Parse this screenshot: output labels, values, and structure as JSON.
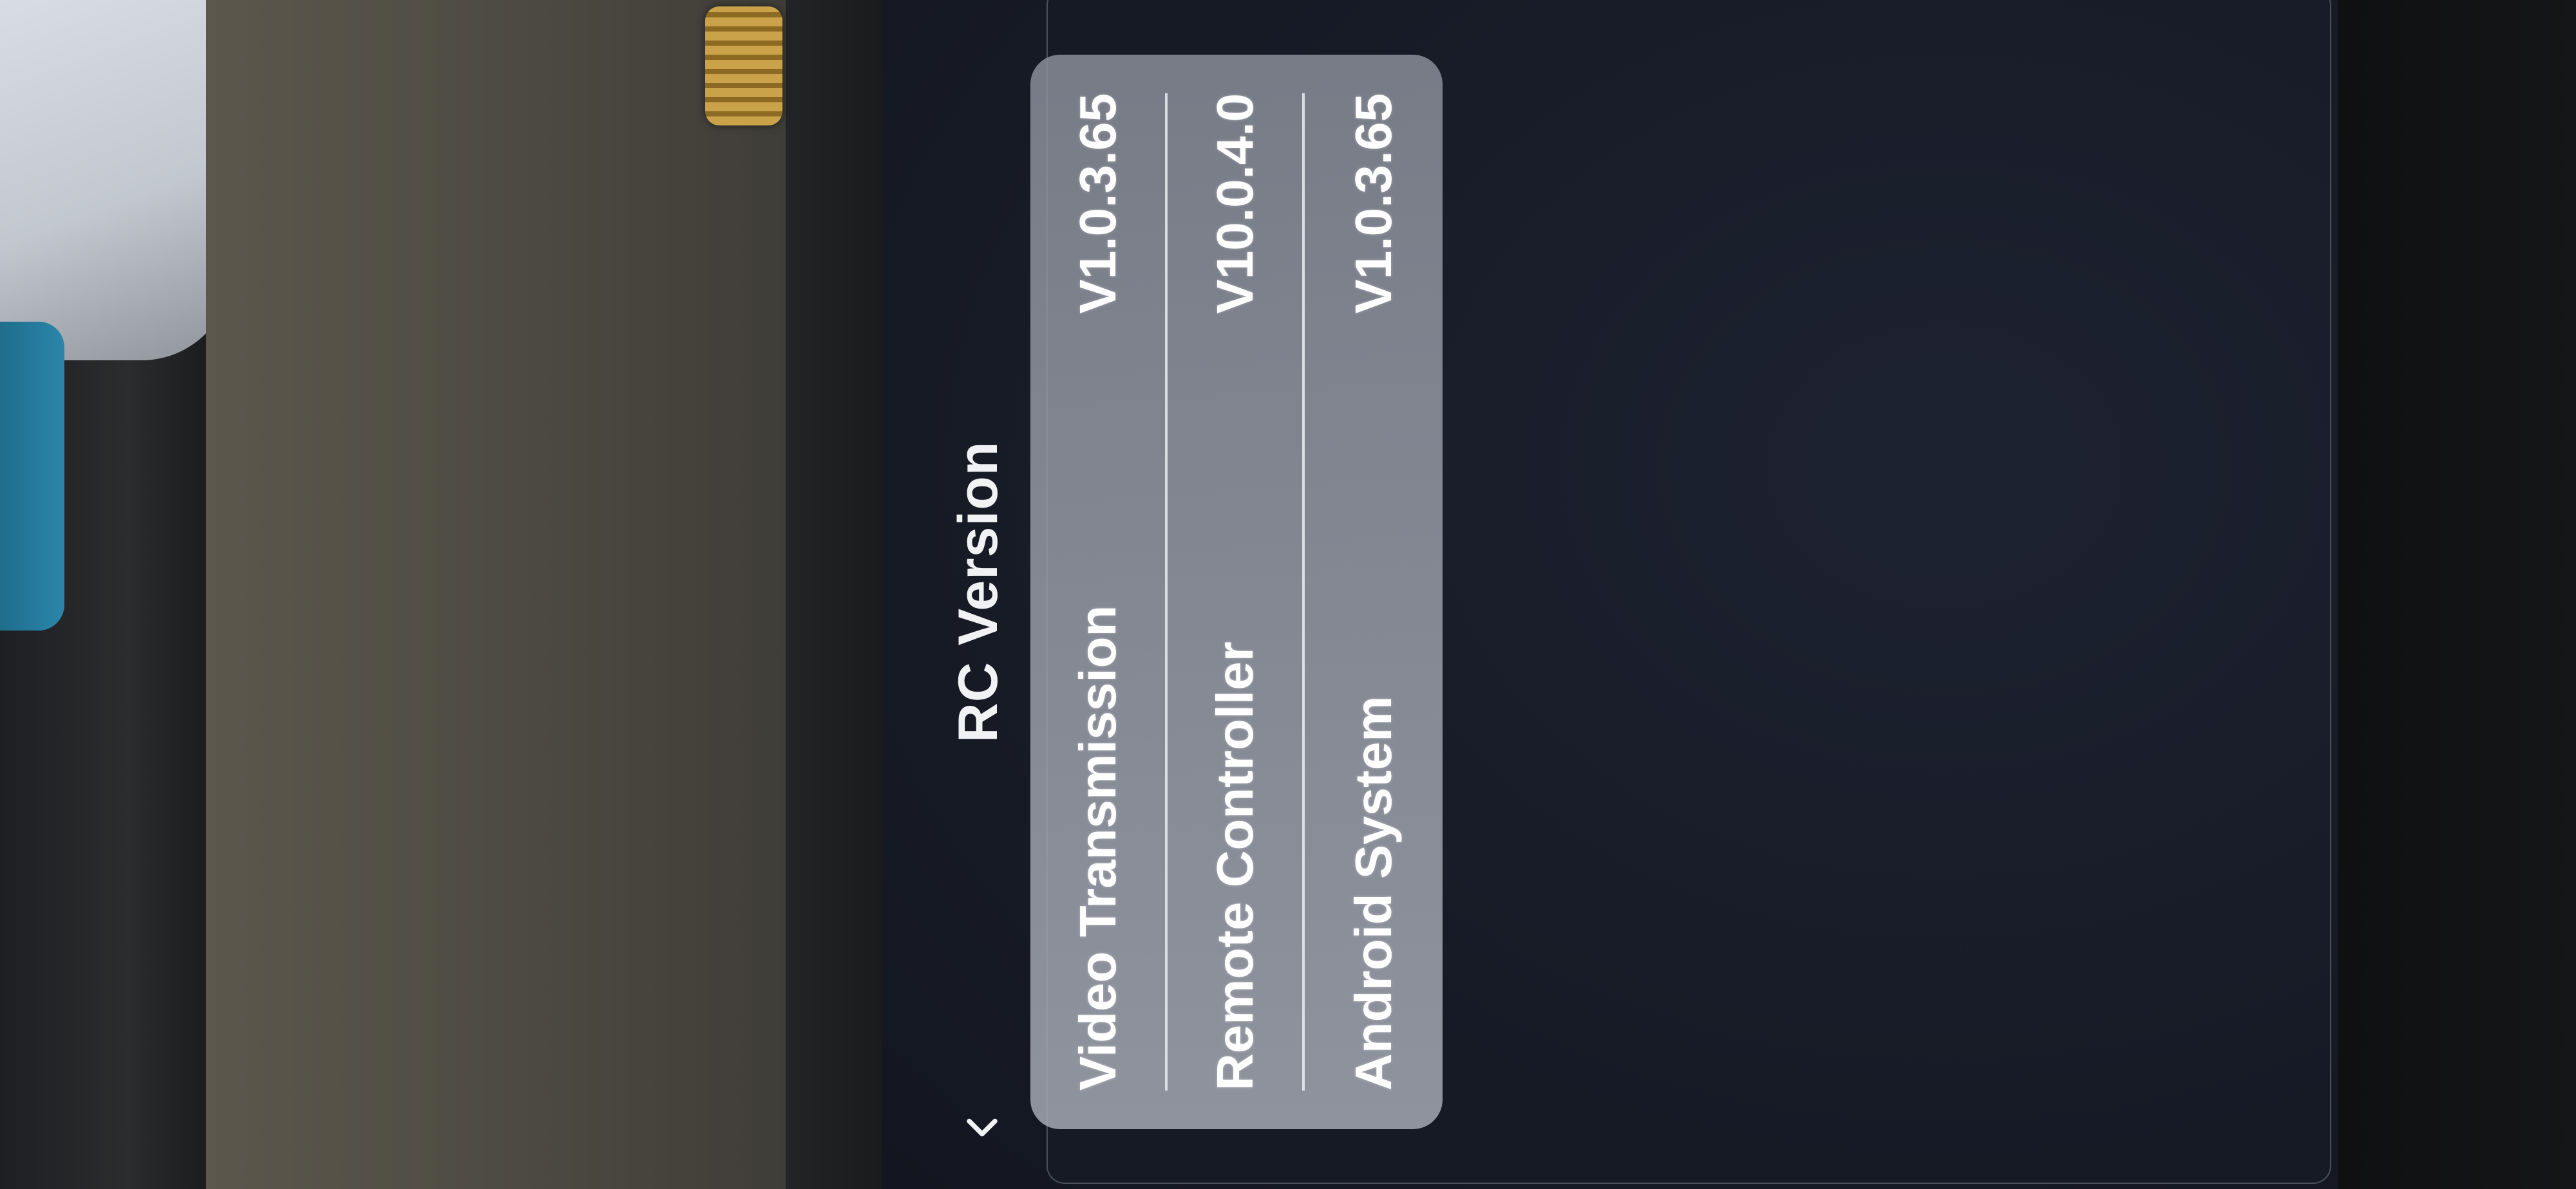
{
  "header": {
    "title": "RC Version",
    "back_icon": "chevron-left-icon"
  },
  "versions": [
    {
      "label": "Video Transmission",
      "value": "V1.0.3.65"
    },
    {
      "label": "Remote Controller",
      "value": "V10.0.4.0"
    },
    {
      "label": "Android System",
      "value": "V1.0.3.65"
    }
  ],
  "colors": {
    "screen_bg": "#181c27",
    "card_bg": "#9ea2ac",
    "text": "#ffffff"
  }
}
